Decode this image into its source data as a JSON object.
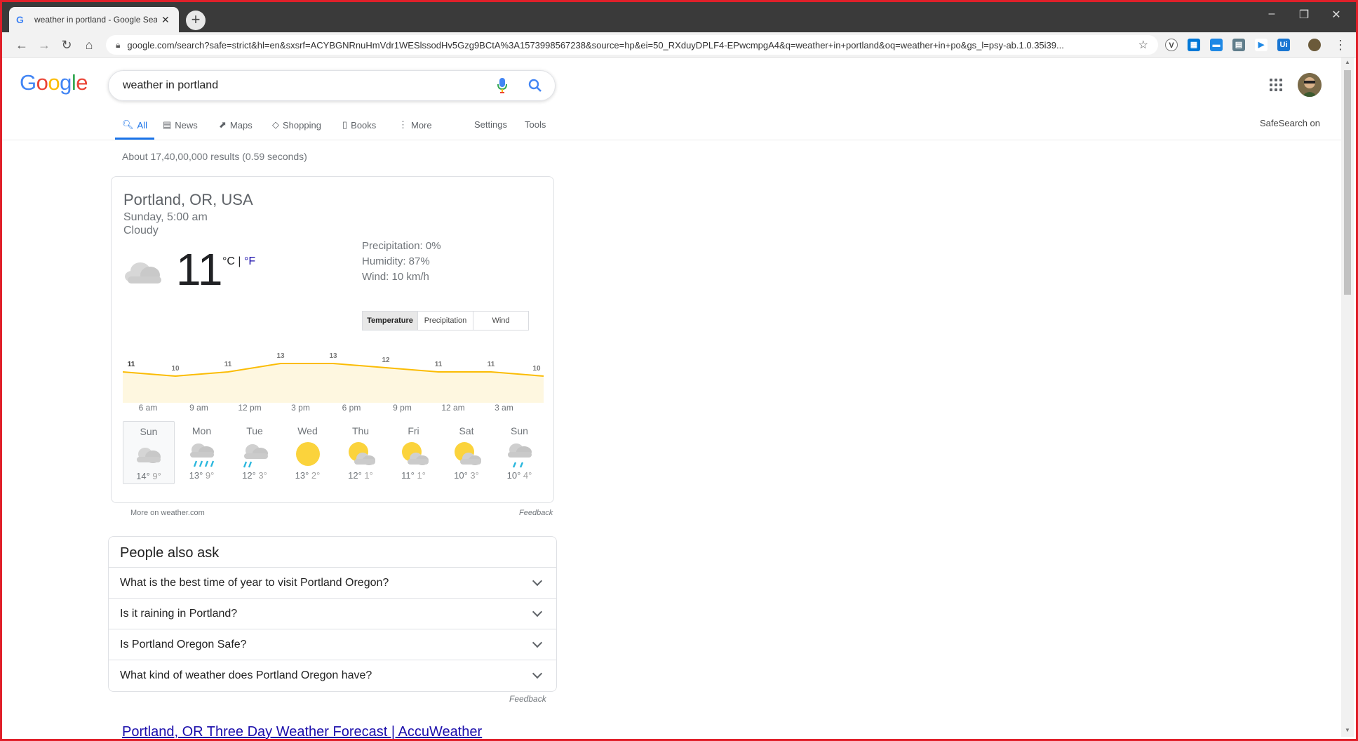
{
  "browser": {
    "tab_title": "weather in portland - Google Sea",
    "tab_close": "✕",
    "new_tab": "+",
    "url": "google.com/search?safe=strict&hl=en&sxsrf=ACYBGNRnuHmVdr1WESlssodHv5Gzg9BCtA%3A1573998567238&source=hp&ei=50_RXduyDPLF4-EPwcmpgA4&q=weather+in+portland&oq=weather+in+po&gs_l=psy-ab.1.0.35i39...",
    "window_minimize": "–",
    "window_restore": "❐",
    "window_close": "✕"
  },
  "google": {
    "logo_letters": [
      "G",
      "o",
      "o",
      "g",
      "l",
      "e"
    ],
    "logo_colors": [
      "#4285f4",
      "#ea4335",
      "#fbbc05",
      "#4285f4",
      "#34a853",
      "#ea4335"
    ],
    "query": "weather in portland",
    "safesearch": "SafeSearch on"
  },
  "nav": {
    "all": "All",
    "news": "News",
    "maps": "Maps",
    "shopping": "Shopping",
    "books": "Books",
    "more": "More",
    "settings": "Settings",
    "tools": "Tools"
  },
  "stats": "About 17,40,00,000 results (0.59 seconds)",
  "weather": {
    "location": "Portland, OR, USA",
    "time": "Sunday, 5:00 am",
    "condition": "Cloudy",
    "temp": "11",
    "unit_c": "°C",
    "unit_sep": " | ",
    "unit_f": "°F",
    "precipitation": "Precipitation: 0%",
    "humidity": "Humidity: 87%",
    "wind": "Wind: 10 km/h",
    "tabs": [
      "Temperature",
      "Precipitation",
      "Wind"
    ],
    "hourly_temps": [
      11,
      10,
      11,
      13,
      13,
      12,
      11,
      11,
      10
    ],
    "hourly_times": [
      "6 am",
      "9 am",
      "12 pm",
      "3 pm",
      "6 pm",
      "9 pm",
      "12 am",
      "3 am"
    ],
    "days": [
      {
        "name": "Sun",
        "hi": "14°",
        "lo": "9°",
        "icon": "cloudy"
      },
      {
        "name": "Mon",
        "hi": "13°",
        "lo": "9°",
        "icon": "rain"
      },
      {
        "name": "Tue",
        "hi": "12°",
        "lo": "3°",
        "icon": "light-rain"
      },
      {
        "name": "Wed",
        "hi": "13°",
        "lo": "2°",
        "icon": "sunny"
      },
      {
        "name": "Thu",
        "hi": "12°",
        "lo": "1°",
        "icon": "partly-cloudy"
      },
      {
        "name": "Fri",
        "hi": "11°",
        "lo": "1°",
        "icon": "partly-cloudy"
      },
      {
        "name": "Sat",
        "hi": "10°",
        "lo": "3°",
        "icon": "partly-cloudy"
      },
      {
        "name": "Sun",
        "hi": "10°",
        "lo": "4°",
        "icon": "showers"
      }
    ],
    "more_link": "More on weather.com",
    "feedback": "Feedback"
  },
  "people_also_ask": {
    "title": "People also ask",
    "questions": [
      "What is the best time of year to visit Portland Oregon?",
      "Is it raining in Portland?",
      "Is Portland Oregon Safe?",
      "What kind of weather does Portland Oregon have?"
    ],
    "feedback": "Feedback"
  },
  "next_result": "Portland, OR Three Day Weather Forecast | AccuWeather"
}
